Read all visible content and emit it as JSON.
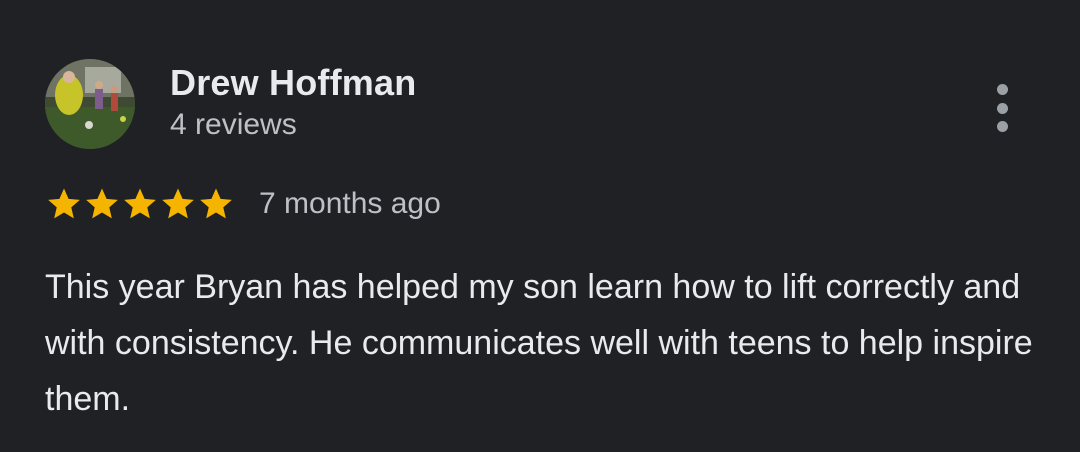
{
  "review": {
    "author": {
      "name": "Drew Hoffman",
      "reviews_count": "4 reviews",
      "avatar": "avatar-photo-icon"
    },
    "rating": {
      "stars": 5,
      "max_stars": 5,
      "star_icon": "star-icon",
      "star_color": "#f4b400"
    },
    "date": "7 months ago",
    "text": "This year Bryan has helped my son learn how to lift correctly and with consistency. He communicates well with teens to help inspire them.",
    "more_icon": "more-vert-icon"
  },
  "colors": {
    "background": "#202124",
    "primary_text": "#e8eaed",
    "secondary_text": "#bdc1c6",
    "icon_gray": "#9aa0a6"
  }
}
